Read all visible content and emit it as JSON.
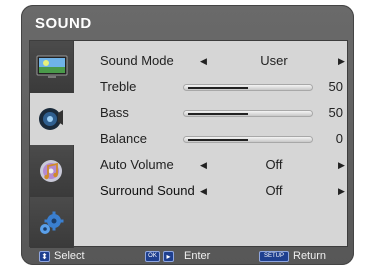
{
  "menu": {
    "title": "SOUND"
  },
  "tabs": [
    {
      "icon": "picture-icon"
    },
    {
      "icon": "sound-icon"
    },
    {
      "icon": "music-disc-icon"
    },
    {
      "icon": "settings-gears-icon"
    }
  ],
  "rows": [
    {
      "label": "Sound Mode",
      "type": "select",
      "value": "User"
    },
    {
      "label": "Treble",
      "type": "slider",
      "value": "50",
      "level": 0.5
    },
    {
      "label": "Bass",
      "type": "slider",
      "value": "50",
      "level": 0.5
    },
    {
      "label": "Balance",
      "type": "slider",
      "value": "0",
      "level": 0.5
    },
    {
      "label": "Auto Volume",
      "type": "select",
      "value": "Off"
    },
    {
      "label": "Surround Sound",
      "type": "select",
      "value": "Off"
    }
  ],
  "footer": {
    "select_label": "Select",
    "enter_key": "OK",
    "enter_label": "Enter",
    "return_key": "SETUP",
    "return_label": "Return"
  },
  "colors": {
    "frame": "#616161",
    "panel": "#d6d6d6",
    "key_blue": "#1e3f8f"
  }
}
